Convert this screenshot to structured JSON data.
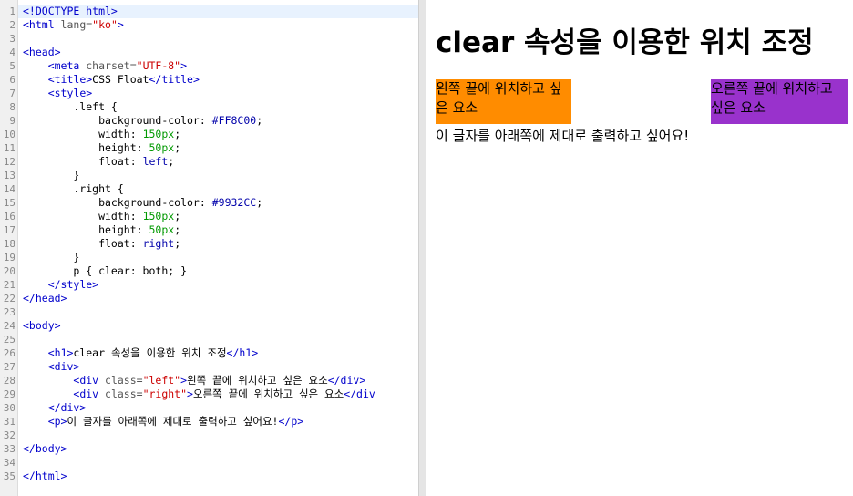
{
  "editor": {
    "active_line": 1,
    "lines": [
      [
        {
          "t": "<!DOCTYPE html>",
          "c": "tag"
        }
      ],
      [
        {
          "t": "<html ",
          "c": "tag"
        },
        {
          "t": "lang=",
          "c": "attr"
        },
        {
          "t": "\"ko\"",
          "c": "str"
        },
        {
          "t": ">",
          "c": "tag"
        }
      ],
      [],
      [
        {
          "t": "<head>",
          "c": "tag"
        }
      ],
      [
        {
          "t": "    "
        },
        {
          "t": "<meta ",
          "c": "tag"
        },
        {
          "t": "charset=",
          "c": "attr"
        },
        {
          "t": "\"UTF-8\"",
          "c": "str"
        },
        {
          "t": ">",
          "c": "tag"
        }
      ],
      [
        {
          "t": "    "
        },
        {
          "t": "<title>",
          "c": "tag"
        },
        {
          "t": "CSS Float"
        },
        {
          "t": "</title>",
          "c": "tag"
        }
      ],
      [
        {
          "t": "    "
        },
        {
          "t": "<style>",
          "c": "tag"
        }
      ],
      [
        {
          "t": "        .left {",
          "c": "sel"
        }
      ],
      [
        {
          "t": "            background-color: ",
          "c": "prop"
        },
        {
          "t": "#FF8C00",
          "c": "val"
        },
        {
          "t": ";"
        }
      ],
      [
        {
          "t": "            width: ",
          "c": "prop"
        },
        {
          "t": "150px",
          "c": "num"
        },
        {
          "t": ";"
        }
      ],
      [
        {
          "t": "            height: ",
          "c": "prop"
        },
        {
          "t": "50px",
          "c": "num"
        },
        {
          "t": ";"
        }
      ],
      [
        {
          "t": "            float: ",
          "c": "prop"
        },
        {
          "t": "left",
          "c": "val"
        },
        {
          "t": ";"
        }
      ],
      [
        {
          "t": "        }"
        }
      ],
      [
        {
          "t": "        .right {",
          "c": "sel"
        }
      ],
      [
        {
          "t": "            background-color: ",
          "c": "prop"
        },
        {
          "t": "#9932CC",
          "c": "val"
        },
        {
          "t": ";"
        }
      ],
      [
        {
          "t": "            width: ",
          "c": "prop"
        },
        {
          "t": "150px",
          "c": "num"
        },
        {
          "t": ";"
        }
      ],
      [
        {
          "t": "            height: ",
          "c": "prop"
        },
        {
          "t": "50px",
          "c": "num"
        },
        {
          "t": ";"
        }
      ],
      [
        {
          "t": "            float: ",
          "c": "prop"
        },
        {
          "t": "right",
          "c": "val"
        },
        {
          "t": ";"
        }
      ],
      [
        {
          "t": "        }"
        }
      ],
      [
        {
          "t": "        p { clear: both; }"
        }
      ],
      [
        {
          "t": "    "
        },
        {
          "t": "</style>",
          "c": "tag"
        }
      ],
      [
        {
          "t": "</head>",
          "c": "tag"
        }
      ],
      [],
      [
        {
          "t": "<body>",
          "c": "tag"
        }
      ],
      [],
      [
        {
          "t": "    "
        },
        {
          "t": "<h1>",
          "c": "tag"
        },
        {
          "t": "clear 속성을 이용한 위치 조정"
        },
        {
          "t": "</h1>",
          "c": "tag"
        }
      ],
      [
        {
          "t": "    "
        },
        {
          "t": "<div>",
          "c": "tag"
        }
      ],
      [
        {
          "t": "        "
        },
        {
          "t": "<div ",
          "c": "tag"
        },
        {
          "t": "class=",
          "c": "attr"
        },
        {
          "t": "\"left\"",
          "c": "str"
        },
        {
          "t": ">",
          "c": "tag"
        },
        {
          "t": "왼쪽 끝에 위치하고 싶은 요소"
        },
        {
          "t": "</div>",
          "c": "tag"
        }
      ],
      [
        {
          "t": "        "
        },
        {
          "t": "<div ",
          "c": "tag"
        },
        {
          "t": "class=",
          "c": "attr"
        },
        {
          "t": "\"right\"",
          "c": "str"
        },
        {
          "t": ">",
          "c": "tag"
        },
        {
          "t": "오른쪽 끝에 위치하고 싶은 요소"
        },
        {
          "t": "</div",
          "c": "tag"
        }
      ],
      [
        {
          "t": "    "
        },
        {
          "t": "</div>",
          "c": "tag"
        }
      ],
      [
        {
          "t": "    "
        },
        {
          "t": "<p>",
          "c": "tag"
        },
        {
          "t": "이 글자를 아래쪽에 제대로 출력하고 싶어요!"
        },
        {
          "t": "</p>",
          "c": "tag"
        }
      ],
      [],
      [
        {
          "t": "</body>",
          "c": "tag"
        }
      ],
      [],
      [
        {
          "t": "</html>",
          "c": "tag"
        }
      ]
    ]
  },
  "preview": {
    "heading": "clear 속성을 이용한 위치 조정",
    "left_box": "왼쪽 끝에 위치하고 싶은 요소",
    "right_box": "오른쪽 끝에 위치하고 싶은 요소",
    "paragraph": "이 글자를 아래쪽에 제대로 출력하고 싶어요!",
    "left_color": "#FF8C00",
    "right_color": "#9932CC"
  }
}
